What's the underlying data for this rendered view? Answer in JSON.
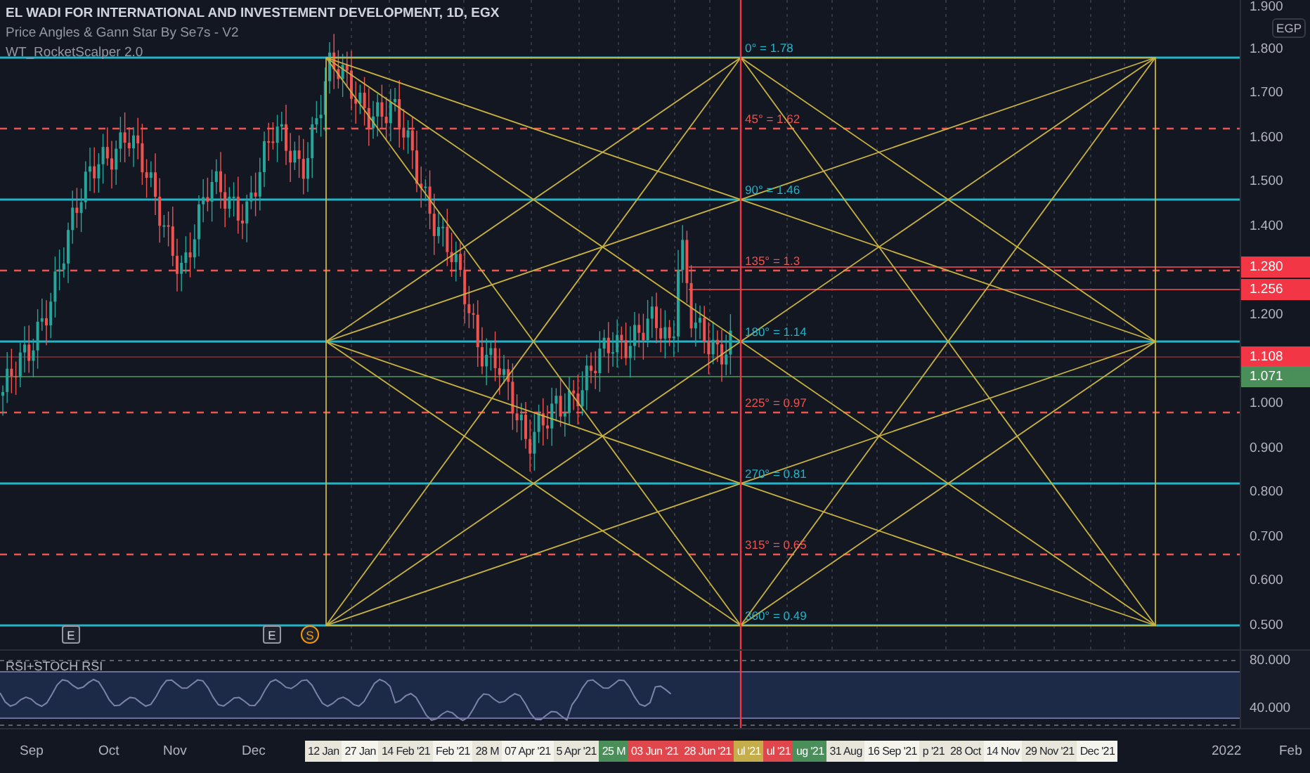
{
  "header": {
    "symbol": "EL WADI FOR INTERNATIONAL AND INVESTEMENT DEVELOPMENT, 1D, EGX",
    "indicators": [
      "Price Angles & Gann Star By Se7s - V2",
      "WT_RocketScalper 2.0"
    ]
  },
  "currency": "EGP",
  "levels": [
    {
      "label": "0° = 1.78",
      "kind": "solid"
    },
    {
      "label": "45° = 1.62",
      "kind": "dashed"
    },
    {
      "label": "90° = 1.46",
      "kind": "solid"
    },
    {
      "label": "135° = 1.3",
      "kind": "dashed"
    },
    {
      "label": "180° = 1.14",
      "kind": "solid"
    },
    {
      "label": "225° = 0.97",
      "kind": "dashed"
    },
    {
      "label": "270° = 0.81",
      "kind": "solid"
    },
    {
      "label": "315° = 0.65",
      "kind": "dashed"
    },
    {
      "label": "360° = 0.49",
      "kind": "solid"
    }
  ],
  "price_ticks": [
    "1.900",
    "1.800",
    "1.700",
    "1.600",
    "1.500",
    "1.400",
    "1.200",
    "1.000",
    "0.900",
    "0.800",
    "0.700",
    "0.600",
    "0.500"
  ],
  "price_markers": [
    {
      "value": "1.280",
      "color": "#f23645"
    },
    {
      "value": "1.256",
      "color": "#f23645"
    },
    {
      "value": "1.108",
      "color": "#f23645"
    },
    {
      "value": "1.071",
      "color": "#4a8f5a"
    }
  ],
  "events": [
    {
      "label": "E",
      "kind": "earnings"
    },
    {
      "label": "E",
      "kind": "earnings"
    },
    {
      "label": "S",
      "kind": "split"
    }
  ],
  "rsi": {
    "title": "RSI+STOCH RSI",
    "ticks": [
      "80.000",
      "40.000"
    ]
  },
  "time_axis": [
    {
      "label": "Sep",
      "kind": "plain"
    },
    {
      "label": "Oct",
      "kind": "plain"
    },
    {
      "label": "Nov",
      "kind": "plain"
    },
    {
      "label": "Dec",
      "kind": "plain"
    },
    {
      "label": "12 Jan",
      "kind": "badge",
      "color": "#e8e6da"
    },
    {
      "label": "27 Jan",
      "kind": "badge",
      "color": "#f4f3ec"
    },
    {
      "label": "14 Feb '21",
      "kind": "badge",
      "color": "#e8e6da"
    },
    {
      "label": "Feb '21",
      "kind": "badge",
      "color": "#f4f3ec"
    },
    {
      "label": "28 M",
      "kind": "badge",
      "color": "#e8e6da"
    },
    {
      "label": "07 Apr '21",
      "kind": "badge",
      "color": "#f4f3ec"
    },
    {
      "label": "5 Apr '21",
      "kind": "badge",
      "color": "#e8e6da"
    },
    {
      "label": "25 M",
      "kind": "badge",
      "color": "#4a8f5a"
    },
    {
      "label": "03 Jun '21",
      "kind": "badge",
      "color": "#e0474c"
    },
    {
      "label": "28 Jun '21",
      "kind": "badge",
      "color": "#e0474c"
    },
    {
      "label": "ul '21",
      "kind": "badge",
      "color": "#c4ad4a"
    },
    {
      "label": "ul '21",
      "kind": "badge",
      "color": "#e0474c"
    },
    {
      "label": "ug '21",
      "kind": "badge",
      "color": "#4a8f5a"
    },
    {
      "label": "31 Aug",
      "kind": "badge",
      "color": "#e8e6da"
    },
    {
      "label": "16 Sep '21",
      "kind": "badge",
      "color": "#f4f3ec"
    },
    {
      "label": "p '21",
      "kind": "badge",
      "color": "#e8e6da"
    },
    {
      "label": "28 Oct",
      "kind": "badge",
      "color": "#e8e6da"
    },
    {
      "label": "14 Nov",
      "kind": "badge",
      "color": "#f4f3ec"
    },
    {
      "label": "29 Nov '21",
      "kind": "badge",
      "color": "#e8e6da"
    },
    {
      "label": "Dec '21",
      "kind": "badge",
      "color": "#f4f3ec"
    },
    {
      "label": "2022",
      "kind": "plain"
    },
    {
      "label": "Feb",
      "kind": "plain"
    }
  ]
}
